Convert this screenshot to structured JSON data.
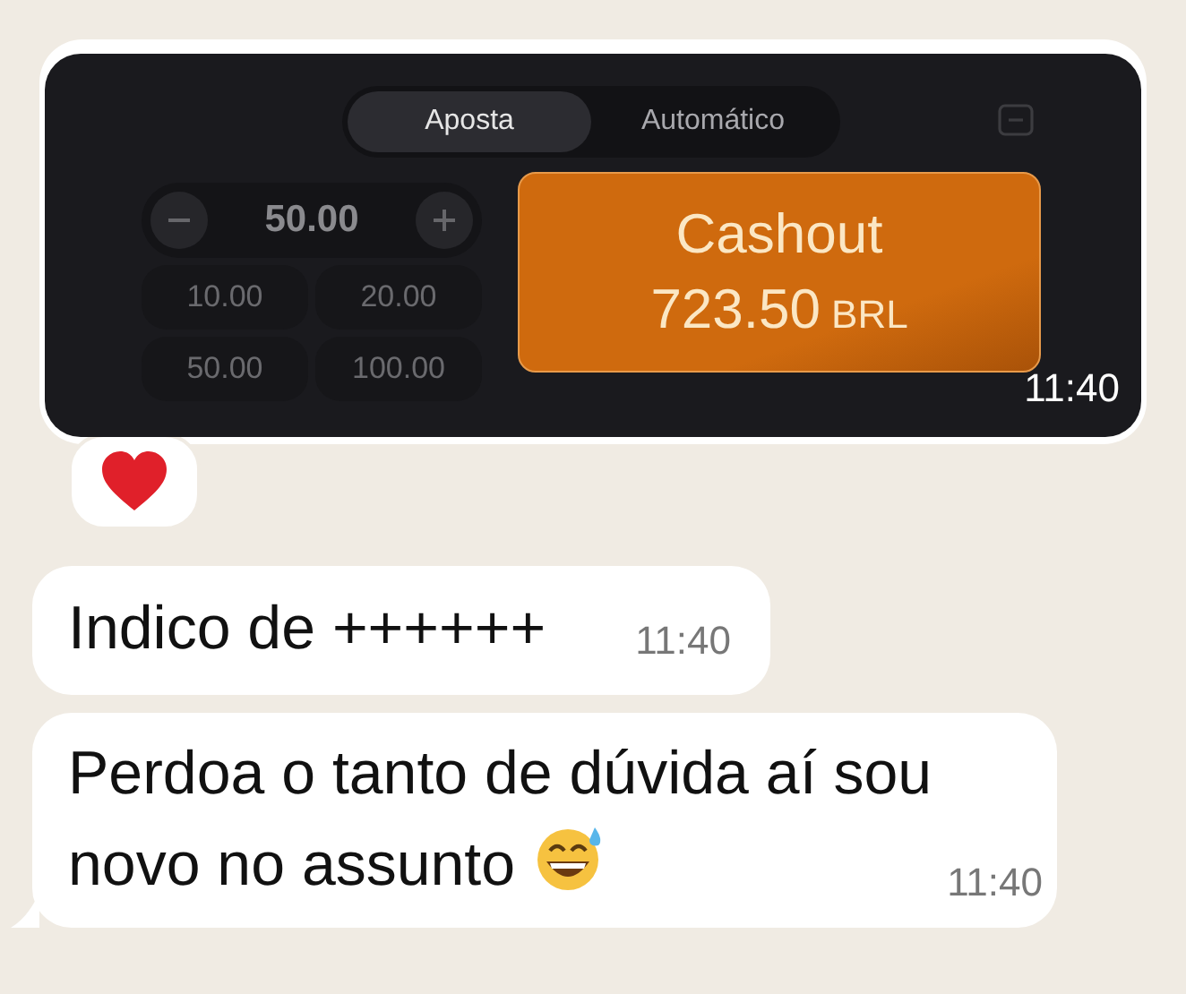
{
  "messages": [
    {
      "kind": "image",
      "time": "11:40",
      "reacted": true,
      "screen": {
        "tabs": [
          {
            "label": "Aposta",
            "selected": true
          },
          {
            "label": "Automático",
            "selected": false
          }
        ],
        "amount": "50.00",
        "presets": [
          "10.00",
          "20.00",
          "50.00",
          "100.00"
        ],
        "cashout": {
          "label": "Cashout",
          "amount": "723.50",
          "currency": "BRL"
        }
      }
    },
    {
      "kind": "text",
      "text": "Indico de ++++++",
      "time": "11:40",
      "emoji": false,
      "tail": false
    },
    {
      "kind": "text",
      "text": "Perdoa o tanto de dúvida aí sou novo no assunto",
      "time": "11:40",
      "emoji": true,
      "tail": true
    }
  ]
}
